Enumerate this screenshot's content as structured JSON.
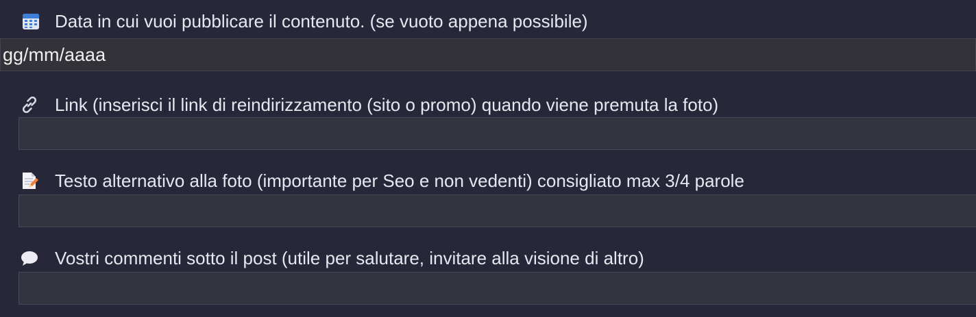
{
  "fields": [
    {
      "icon": "calendar-icon",
      "label": "Data in cui vuoi pubblicare il contenuto. (se vuoto appena possibile)",
      "placeholder": "gg/mm/aaaa",
      "value": ""
    },
    {
      "icon": "link-icon",
      "label": "Link (inserisci il link di reindirizzamento (sito o promo) quando viene premuta la foto)",
      "placeholder": "",
      "value": ""
    },
    {
      "icon": "memo-icon",
      "label": "Testo alternativo alla foto (importante per Seo e non vedenti) consigliato max 3/4 parole",
      "placeholder": "",
      "value": ""
    },
    {
      "icon": "speech-bubble-icon",
      "label": "Vostri commenti sotto il post (utile per salutare, invitare alla visione di altro)",
      "placeholder": "",
      "value": ""
    }
  ],
  "colors": {
    "background": "#272739",
    "input_background": "#343440",
    "text": "#e7e7ef"
  }
}
